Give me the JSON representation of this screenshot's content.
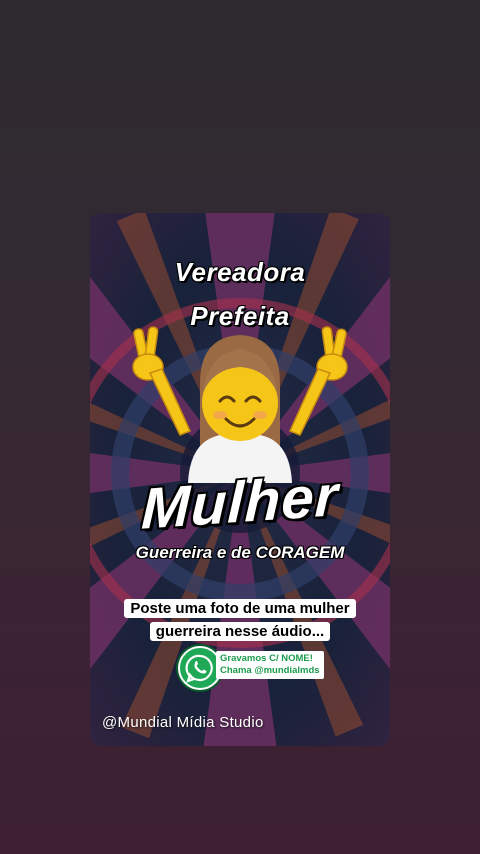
{
  "story": {
    "title_line1": "Vereadora",
    "title_line2": "Prefeita",
    "headline": "Mulher",
    "subtitle": "Guerreira e de CORAGEM",
    "callout_line1": "Poste uma foto de uma mulher",
    "callout_line2": "guerreira nesse áudio...",
    "whatsapp_line1": "Gravamos C/ NOME!",
    "whatsapp_line2": "Chama @mundialmds",
    "studio": "@Mundial  Mídia  Studio"
  },
  "icons": {
    "emoji": "woman-emoji-peace-sign-icon",
    "whatsapp": "whatsapp-icon"
  },
  "colors": {
    "background": "#332a33",
    "whatsapp_green": "#1fa855",
    "card_dark": "#1a2340"
  }
}
